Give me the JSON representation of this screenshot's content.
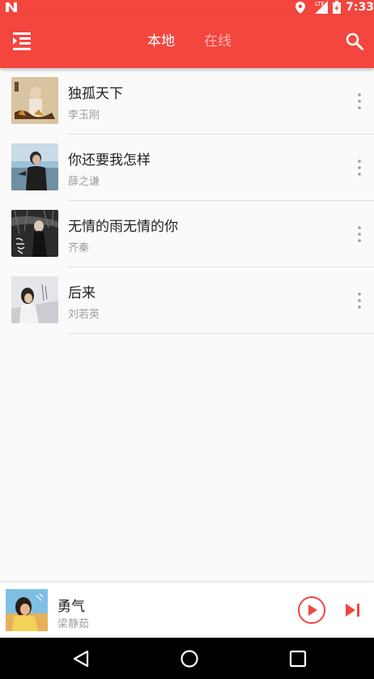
{
  "status_bar": {
    "time": "7:33",
    "network_label": "LTE",
    "icons": [
      "notification-n-icon",
      "location-icon",
      "signal-icon",
      "battery-charging-icon"
    ]
  },
  "app_bar": {
    "tabs": [
      {
        "label": "本地",
        "active": true
      },
      {
        "label": "在线",
        "active": false
      }
    ],
    "icons": [
      "menu-list-icon",
      "search-icon"
    ],
    "color": "#f2463e"
  },
  "songs": [
    {
      "title": "独孤天下",
      "artist": "李玉刚"
    },
    {
      "title": "你还要我怎样",
      "artist": "薛之谦"
    },
    {
      "title": "无情的雨无情的你",
      "artist": "齐秦"
    },
    {
      "title": "后来",
      "artist": "刘若英"
    }
  ],
  "now_playing": {
    "title": "勇气",
    "artist": "梁静茹",
    "icons": [
      "play-circle-icon",
      "skip-next-icon"
    ]
  },
  "nav_bar": {
    "icons": [
      "back-triangle-icon",
      "home-circle-icon",
      "recents-square-icon"
    ]
  }
}
